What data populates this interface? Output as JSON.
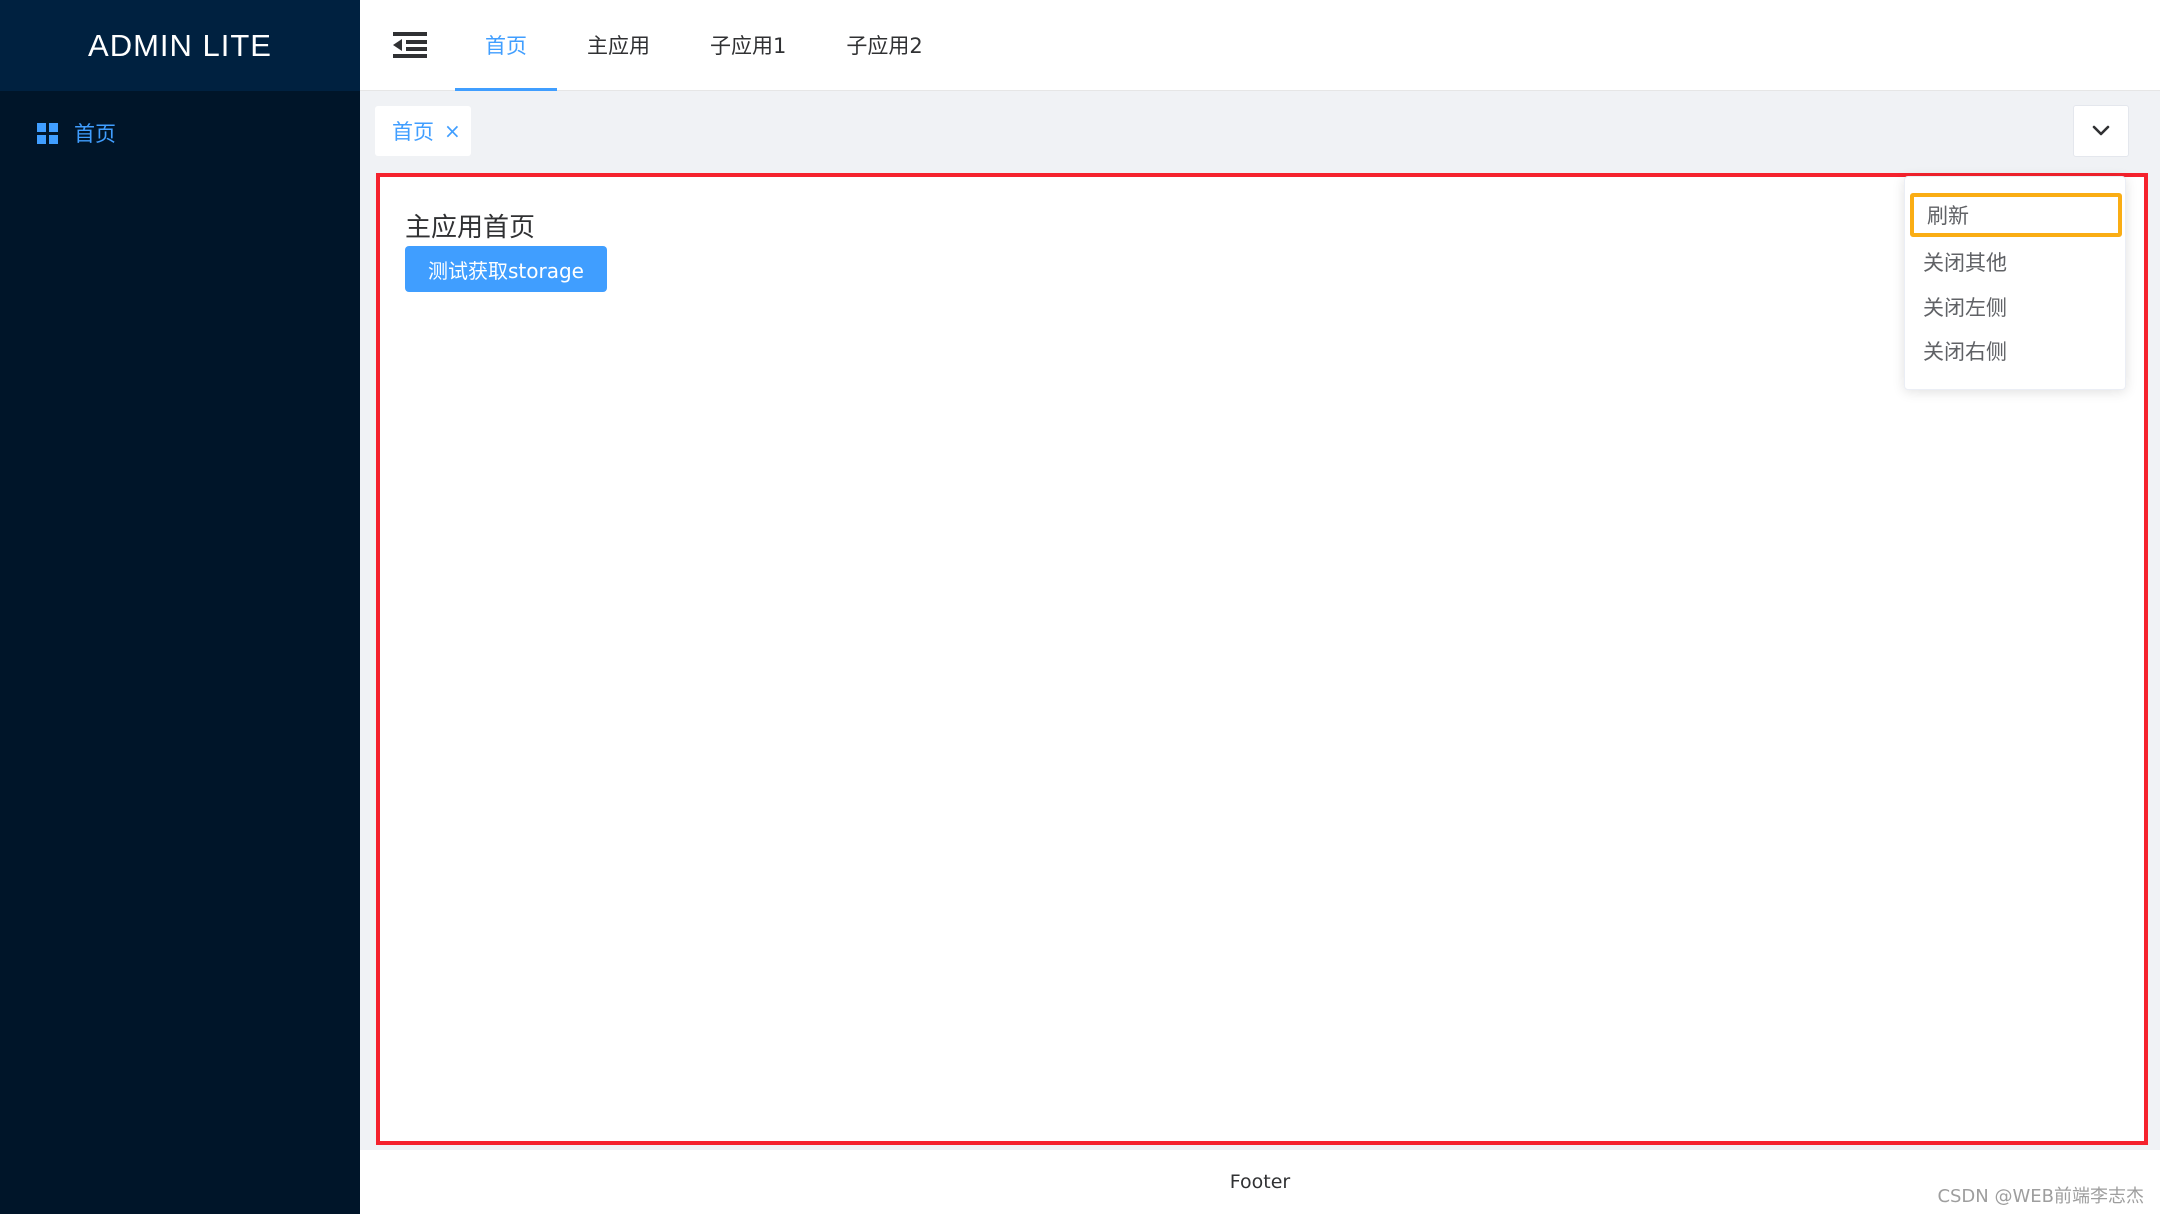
{
  "sidebar": {
    "logo": "ADMIN LITE",
    "items": [
      {
        "label": "首页",
        "icon": "grid-icon"
      }
    ]
  },
  "header": {
    "toggle_icon": "menu-fold-icon",
    "tabs": [
      {
        "label": "首页",
        "active": true
      },
      {
        "label": "主应用",
        "active": false
      },
      {
        "label": "子应用1",
        "active": false
      },
      {
        "label": "子应用2",
        "active": false
      }
    ]
  },
  "tags_bar": {
    "tags": [
      {
        "label": "首页",
        "close": "×"
      }
    ],
    "dropdown_icon": "chevron-down-icon"
  },
  "dropdown_menu": {
    "items": [
      {
        "label": "刷新"
      },
      {
        "label": "关闭其他"
      },
      {
        "label": "关闭左侧"
      },
      {
        "label": "关闭右侧"
      }
    ]
  },
  "content": {
    "title": "主应用首页",
    "button_label": "测试获取storage"
  },
  "footer": {
    "text": "Footer"
  },
  "watermark": "CSDN @WEB前端李志杰",
  "colors": {
    "sidebar_bg": "#001529",
    "logo_bg": "#002140",
    "primary": "#409eff",
    "content_outline": "#f5222d",
    "menu_highlight_outline": "#faad14"
  }
}
